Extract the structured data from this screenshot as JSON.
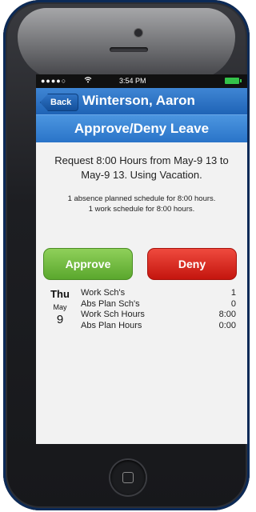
{
  "status_bar": {
    "signal": "●●●●○",
    "wifi_icon": "wifi-icon",
    "time": "3:54 PM",
    "battery_icon": "battery-icon"
  },
  "nav": {
    "back_label": "Back",
    "title": "Winterson, Aaron"
  },
  "header": {
    "title": "Approve/Deny Leave"
  },
  "request": {
    "text": "Request 8:00 Hours from May-9 13 to May-9 13. Using Vacation.",
    "summary_line1": "1 absence planned schedule for 8:00 hours.",
    "summary_line2": "1 work schedule for 8:00 hours."
  },
  "actions": {
    "approve_label": "Approve",
    "deny_label": "Deny"
  },
  "day": {
    "dow": "Thu",
    "month": "May",
    "date": "9",
    "rows": [
      {
        "label": "Work Sch's",
        "value": "1"
      },
      {
        "label": "Abs Plan Sch's",
        "value": "0"
      },
      {
        "label": "Work Sch Hours",
        "value": "8:00"
      },
      {
        "label": "Abs Plan Hours",
        "value": "0:00"
      }
    ]
  },
  "colors": {
    "nav_blue": "#1f63b6",
    "approve_green": "#5aa72d",
    "deny_red": "#c4150e"
  }
}
